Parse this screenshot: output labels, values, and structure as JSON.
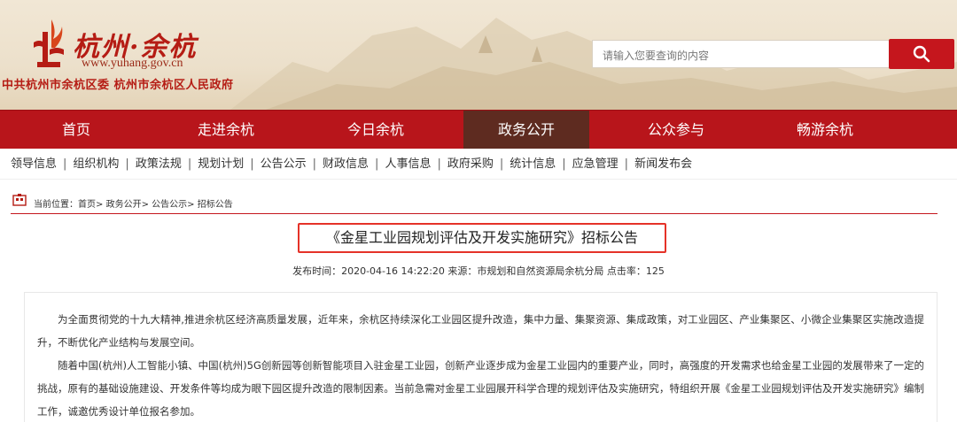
{
  "header": {
    "logo_title": "杭州·余杭",
    "logo_url": "www.yuhang.gov.cn",
    "party_line": "中共杭州市余杭区委 杭州市余杭区人民政府",
    "search_placeholder": "请输入您要查询的内容",
    "colors": {
      "brand_red": "#b8151b",
      "active_tab": "#5e2b20",
      "banner_bg": "#ece0cb"
    }
  },
  "mainnav": {
    "items": [
      {
        "label": "首页"
      },
      {
        "label": "走进余杭"
      },
      {
        "label": "今日余杭"
      },
      {
        "label": "政务公开",
        "active": true
      },
      {
        "label": "公众参与"
      },
      {
        "label": "畅游余杭"
      }
    ]
  },
  "subnav": {
    "items": [
      "领导信息",
      "组织机构",
      "政策法规",
      "规划计划",
      "公告公示",
      "财政信息",
      "人事信息",
      "政府采购",
      "统计信息",
      "应急管理",
      "新闻发布会"
    ]
  },
  "breadcrumb": {
    "prefix": "当前位置：",
    "items": [
      "首页",
      "政务公开",
      "公告公示",
      "招标公告"
    ],
    "separator": ">"
  },
  "article": {
    "title": "《金星工业园规划评估及开发实施研究》招标公告",
    "meta": "发布时间：2020-04-16 14:22:20 来源：市规划和自然资源局余杭分局 点击率：125",
    "paragraphs": [
      "为全面贯彻党的十九大精神,推进余杭区经济高质量发展，近年来，余杭区持续深化工业园区提升改造，集中力量、集聚资源、集成政策，对工业园区、产业集聚区、小微企业集聚区实施改造提升，不断优化产业结构与发展空间。",
      "随着中国(杭州)人工智能小镇、中国(杭州)5G创新园等创新智能项目入驻金星工业园，创新产业逐步成为金星工业园内的重要产业，同时，高强度的开发需求也给金星工业园的发展带来了一定的挑战，原有的基础设施建设、开发条件等均成为眼下园区提升改造的限制因素。当前急需对金星工业园展开科学合理的规划评估及实施研究，特组织开展《金星工业园规划评估及开发实施研究》编制工作，诚邀优秀设计单位报名参加。"
    ]
  }
}
